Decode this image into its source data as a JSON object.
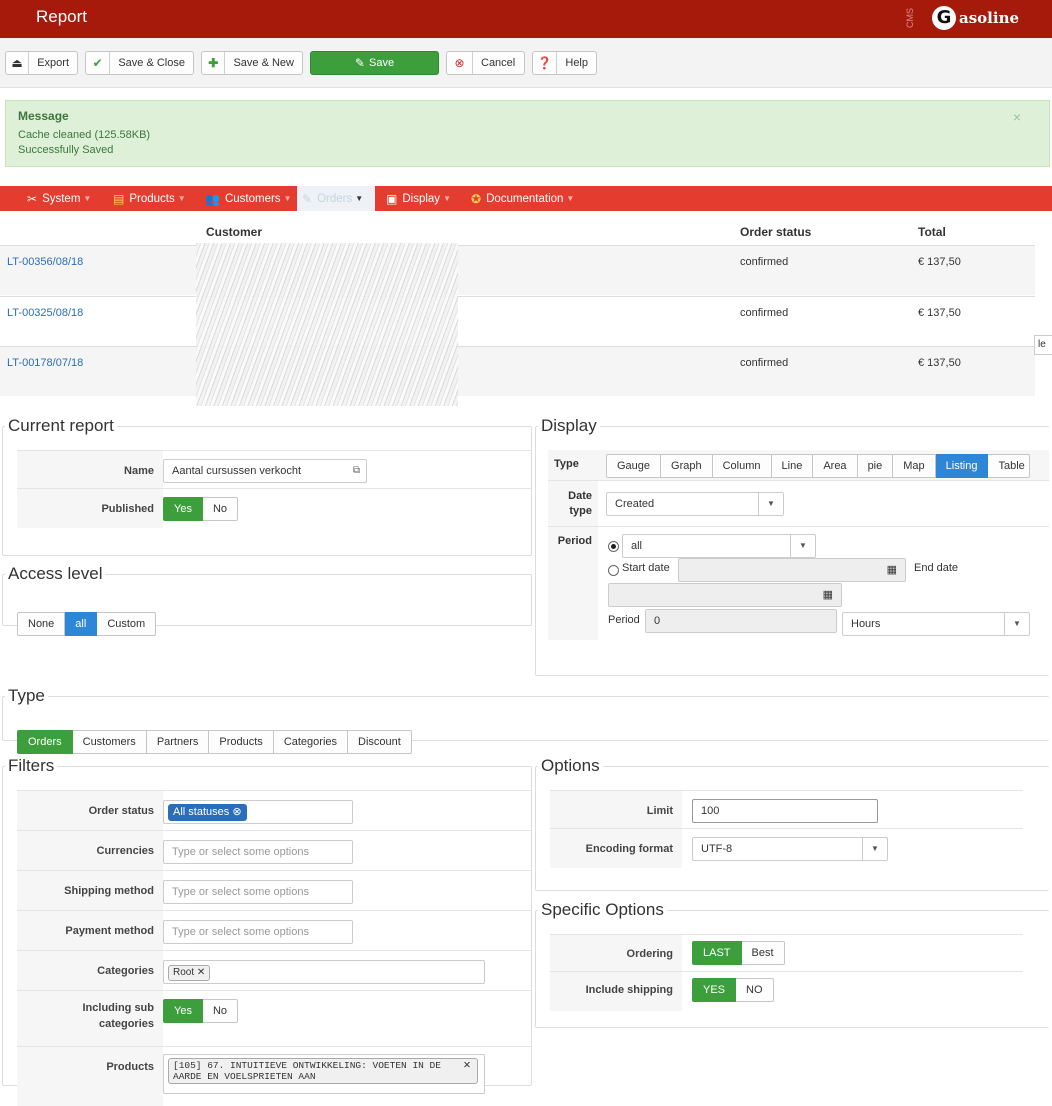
{
  "header": {
    "title": "Report",
    "cms_label": "CMS",
    "logo_letter": "G",
    "logo_text": "asoline"
  },
  "toolbar": {
    "export": "Export",
    "save_close": "Save & Close",
    "save_new": "Save & New",
    "save": "Save",
    "cancel": "Cancel",
    "help": "Help"
  },
  "message": {
    "heading": "Message",
    "line1": "Cache cleaned (125.58KB)",
    "line2": "Successfully Saved",
    "close": "×"
  },
  "menu": {
    "system": "System",
    "products": "Products",
    "customers": "Customers",
    "orders": "Orders",
    "display": "Display",
    "documentation": "Documentation"
  },
  "orders_table": {
    "headers": {
      "customer": "Customer",
      "status": "Order status",
      "total": "Total"
    },
    "rows": [
      {
        "number": "LT-00356/08/18",
        "status": "confirmed",
        "total": "€ 137,50"
      },
      {
        "number": "LT-00325/08/18",
        "status": "confirmed",
        "total": "€ 137,50"
      },
      {
        "number": "LT-00178/07/18",
        "status": "confirmed",
        "total": "€ 137,50"
      }
    ]
  },
  "edge_label": "le",
  "current_report": {
    "legend": "Current report",
    "name_label": "Name",
    "name_value": "Aantal cursussen verkocht",
    "published_label": "Published",
    "yes": "Yes",
    "no": "No"
  },
  "access_level": {
    "legend": "Access level",
    "none": "None",
    "all": "all",
    "custom": "Custom"
  },
  "display": {
    "legend": "Display",
    "type_label": "Type",
    "types": [
      "Gauge",
      "Graph",
      "Column",
      "Line",
      "Area",
      "pie",
      "Map",
      "Listing",
      "Table"
    ],
    "date_type_label_1": "Date",
    "date_type_label_2": "type",
    "date_type_value": "Created",
    "period_label": "Period",
    "period_value": "all",
    "start_date": "Start date",
    "end_date": "End date",
    "period_sub_label": "Period",
    "period_number": "0",
    "period_unit": "Hours"
  },
  "type_section": {
    "legend": "Type",
    "options": [
      "Orders",
      "Customers",
      "Partners",
      "Products",
      "Categories",
      "Discount"
    ]
  },
  "filters": {
    "legend": "Filters",
    "order_status_label": "Order status",
    "order_status_chip": "All statuses",
    "currencies_label": "Currencies",
    "shipping_label": "Shipping method",
    "payment_label": "Payment method",
    "placeholder": "Type or select some options",
    "categories_label": "Categories",
    "categories_chip": "Root",
    "sub_label_1": "Including sub",
    "sub_label_2": "categories",
    "yes": "Yes",
    "no": "No",
    "products_label": "Products",
    "products_chip_1": "[105] 67. INTUITIEVE ONTWIKKELING: VOETEN IN DE",
    "products_chip_2": "AARDE EN VOELSPRIETEN AAN"
  },
  "options": {
    "legend": "Options",
    "limit_label": "Limit",
    "limit_value": "100",
    "encoding_label": "Encoding format",
    "encoding_value": "UTF-8"
  },
  "specific_options": {
    "legend": "Specific Options",
    "ordering_label": "Ordering",
    "last": "LAST",
    "best": "Best",
    "shipping_label": "Include shipping",
    "yes": "YES",
    "no": "NO"
  },
  "colors": {
    "header": "#a51a0b",
    "menubar": "#e43d2f",
    "success": "#3c9f3c",
    "primary": "#2e86d6",
    "link": "#2a6ebb"
  }
}
